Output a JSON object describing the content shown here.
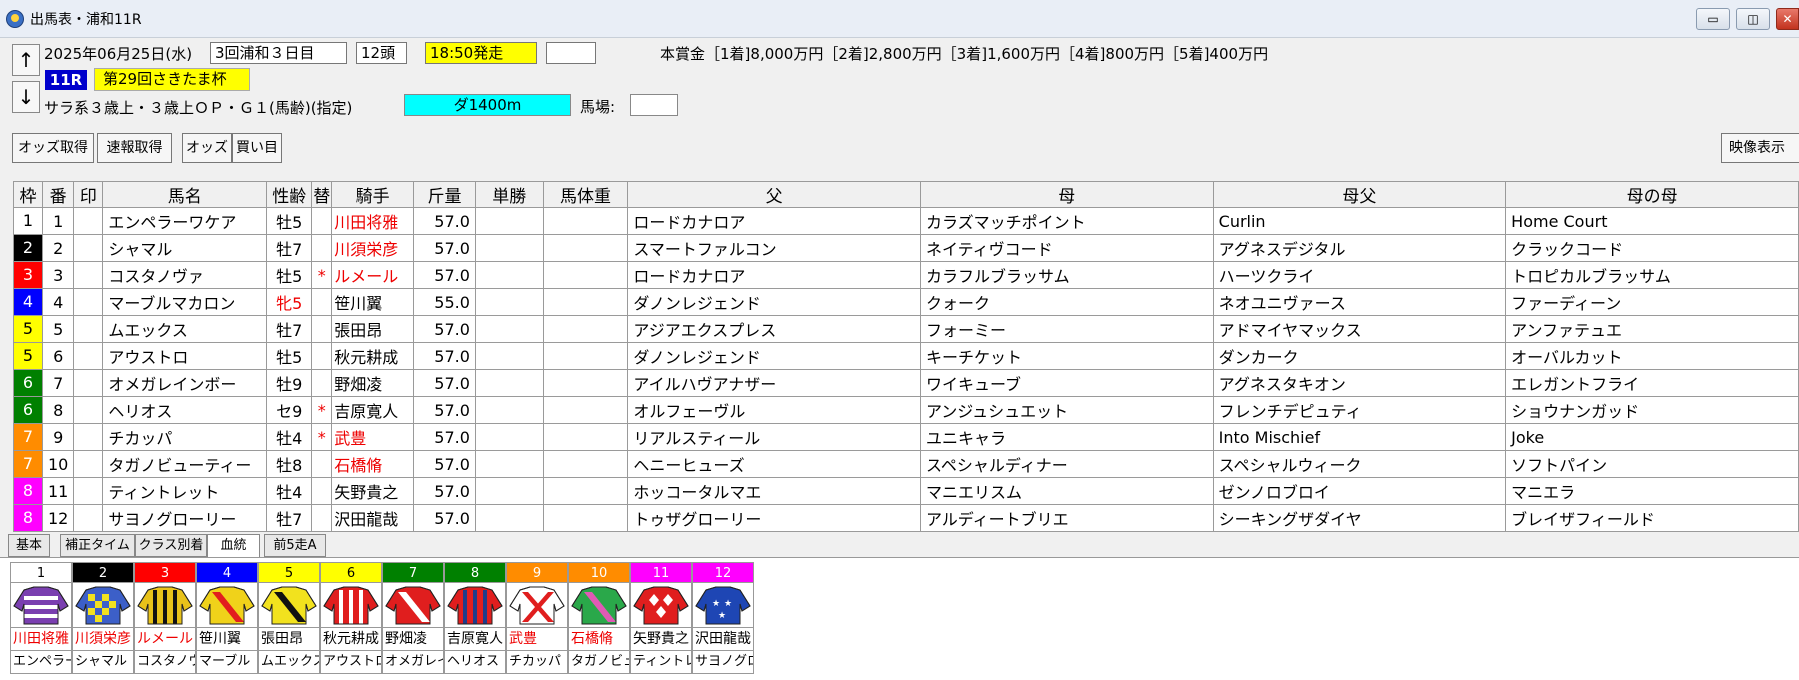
{
  "window": {
    "title": "出馬表・浦和11R",
    "minimize": "▭",
    "restore": "◫",
    "close": "✕"
  },
  "nav": {
    "up": "↑",
    "down": "↓"
  },
  "header": {
    "date": "2025年06月25日(水)",
    "meeting": "3回浦和３日目",
    "heads": "12頭",
    "post_time": "18:50発走",
    "prize": "本賞金［1着]8,000万円［2着]2,800万円［3着]1,600万円［4着]800万円［5着]400万円",
    "race_no": "11R",
    "race_name": "第29回さきたま杯",
    "conditions": "サラ系３歳上・３歳上ＯＰ・Ｇ１(馬齢)(指定)",
    "course": "ダ1400m",
    "baba_label": "馬場:"
  },
  "toolbar": {
    "odds_get": "オッズ取得",
    "sokuho_get": "速報取得",
    "odds": "オッズ",
    "kaime": "買い目",
    "video": "映像表示"
  },
  "table": {
    "headers": [
      "枠",
      "番",
      "印",
      "馬名",
      "性齢",
      "替",
      "騎手",
      "斤量",
      "単勝",
      "馬体重",
      "父",
      "母",
      "母父",
      "母の母"
    ],
    "rows": [
      {
        "waku": "1",
        "num": "1",
        "mark": "",
        "name": "エンペラーワケア",
        "sexage": "牡5",
        "kae": "",
        "jockey": "川田将雅",
        "weight": "57.0",
        "odds": "",
        "bw": "",
        "sire": "ロードカナロア",
        "dam": "カラズマッチポイント",
        "damsire": "Curlin",
        "damdam": "Home Court"
      },
      {
        "waku": "2",
        "num": "2",
        "mark": "",
        "name": "シャマル",
        "sexage": "牡7",
        "kae": "",
        "jockey": "川須栄彦",
        "weight": "57.0",
        "odds": "",
        "bw": "",
        "sire": "スマートファルコン",
        "dam": "ネイティヴコード",
        "damsire": "アグネスデジタル",
        "damdam": "クラックコード"
      },
      {
        "waku": "3",
        "num": "3",
        "mark": "",
        "name": "コスタノヴァ",
        "sexage": "牡5",
        "kae": "*",
        "jockey": "ルメール",
        "weight": "57.0",
        "odds": "",
        "bw": "",
        "sire": "ロードカナロア",
        "dam": "カラフルブラッサム",
        "damsire": "ハーツクライ",
        "damdam": "トロピカルブラッサム"
      },
      {
        "waku": "4",
        "num": "4",
        "mark": "",
        "name": "マーブルマカロン",
        "sexage": "牝5",
        "kae": "",
        "jockey": "笹川翼",
        "weight": "55.0",
        "odds": "",
        "bw": "",
        "sire": "ダノンレジェンド",
        "dam": "クォーク",
        "damsire": "ネオユニヴァース",
        "damdam": "ファーディーン"
      },
      {
        "waku": "5",
        "num": "5",
        "mark": "",
        "name": "ムエックス",
        "sexage": "牡7",
        "kae": "",
        "jockey": "張田昂",
        "weight": "57.0",
        "odds": "",
        "bw": "",
        "sire": "アジアエクスプレス",
        "dam": "フォーミー",
        "damsire": "アドマイヤマックス",
        "damdam": "アンファテュエ"
      },
      {
        "waku": "5",
        "num": "6",
        "mark": "",
        "name": "アウストロ",
        "sexage": "牡5",
        "kae": "",
        "jockey": "秋元耕成",
        "weight": "57.0",
        "odds": "",
        "bw": "",
        "sire": "ダノンレジェンド",
        "dam": "キーチケット",
        "damsire": "ダンカーク",
        "damdam": "オーバルカット"
      },
      {
        "waku": "6",
        "num": "7",
        "mark": "",
        "name": "オメガレインボー",
        "sexage": "牡9",
        "kae": "",
        "jockey": "野畑凌",
        "weight": "57.0",
        "odds": "",
        "bw": "",
        "sire": "アイルハヴアナザー",
        "dam": "ワイキューブ",
        "damsire": "アグネスタキオン",
        "damdam": "エレガントフライ"
      },
      {
        "waku": "6",
        "num": "8",
        "mark": "",
        "name": "ヘリオス",
        "sexage": "セ9",
        "kae": "*",
        "jockey": "吉原寛人",
        "weight": "57.0",
        "odds": "",
        "bw": "",
        "sire": "オルフェーヴル",
        "dam": "アンジュシュエット",
        "damsire": "フレンチデピュティ",
        "damdam": "ショウナンガッド"
      },
      {
        "waku": "7",
        "num": "9",
        "mark": "",
        "name": "チカッパ",
        "sexage": "牡4",
        "kae": "*",
        "jockey": "武豊",
        "weight": "57.0",
        "odds": "",
        "bw": "",
        "sire": "リアルスティール",
        "dam": "ユニキャラ",
        "damsire": "Into Mischief",
        "damdam": "Joke"
      },
      {
        "waku": "7",
        "num": "10",
        "mark": "",
        "name": "タガノビューティー",
        "sexage": "牡8",
        "kae": "",
        "jockey": "石橋脩",
        "weight": "57.0",
        "odds": "",
        "bw": "",
        "sire": "ヘニーヒューズ",
        "dam": "スペシャルディナー",
        "damsire": "スペシャルウィーク",
        "damdam": "ソフトパイン"
      },
      {
        "waku": "8",
        "num": "11",
        "mark": "",
        "name": "ティントレット",
        "sexage": "牡4",
        "kae": "",
        "jockey": "矢野貴之",
        "weight": "57.0",
        "odds": "",
        "bw": "",
        "sire": "ホッコータルマエ",
        "dam": "マニエリスム",
        "damsire": "ゼンノロブロイ",
        "damdam": "マニエラ"
      },
      {
        "waku": "8",
        "num": "12",
        "mark": "",
        "name": "サヨノグローリー",
        "sexage": "牡7",
        "kae": "",
        "jockey": "沢田龍哉",
        "weight": "57.0",
        "odds": "",
        "bw": "",
        "sire": "トゥザグローリー",
        "dam": "アルディートブリエ",
        "damsire": "シーキングザダイヤ",
        "damdam": "ブレイザフィールド"
      }
    ]
  },
  "tabs": [
    "基本",
    "補正タイム",
    "クラス別着",
    "血統",
    "前5走A"
  ],
  "silks": [
    {
      "num": "1",
      "jockey": "川田将雅",
      "horse": "エンペラー"
    },
    {
      "num": "2",
      "jockey": "川須栄彦",
      "horse": "シャマル"
    },
    {
      "num": "3",
      "jockey": "ルメール",
      "horse": "コスタノヴ"
    },
    {
      "num": "4",
      "jockey": "笹川翼",
      "horse": "マーブル"
    },
    {
      "num": "5",
      "jockey": "張田昂",
      "horse": "ムエックス"
    },
    {
      "num": "6",
      "jockey": "秋元耕成",
      "horse": "アウストロ"
    },
    {
      "num": "7",
      "jockey": "野畑凌",
      "horse": "オメガレイ"
    },
    {
      "num": "8",
      "jockey": "吉原寛人",
      "horse": "ヘリオス"
    },
    {
      "num": "9",
      "jockey": "武豊",
      "horse": "チカッパ"
    },
    {
      "num": "10",
      "jockey": "石橋脩",
      "horse": "タガノビュ"
    },
    {
      "num": "11",
      "jockey": "矢野貴之",
      "horse": "ティントレ"
    },
    {
      "num": "12",
      "jockey": "沢田龍哉",
      "horse": "サヨノグロ"
    }
  ],
  "colors": {
    "waku": {
      "1": "#ffffff",
      "2": "#000000",
      "3": "#ff0000",
      "4": "#0000ff",
      "5": "#ffff00",
      "6": "#008000",
      "7": "#ff8c00",
      "8": "#ff00ff"
    },
    "waku_text": {
      "1": "#000000",
      "2": "#ffffff",
      "3": "#ffffff",
      "4": "#ffffff",
      "5": "#000000",
      "6": "#ffffff",
      "7": "#ffffff",
      "8": "#ffffff"
    },
    "red_text": "#ee0000",
    "jersey": [
      {
        "base": "#7a3fb0",
        "accent": "#ffffff",
        "pattern": "hoops"
      },
      {
        "base": "#3c5fc8",
        "accent": "#f2e21e",
        "pattern": "checks"
      },
      {
        "base": "#e8c21a",
        "accent": "#111111",
        "pattern": "stripes"
      },
      {
        "base": "#f0d21a",
        "accent": "#e21e1e",
        "pattern": "sash"
      },
      {
        "base": "#f2e21e",
        "accent": "#111111",
        "pattern": "sash"
      },
      {
        "base": "#e01e1e",
        "accent": "#ffffff",
        "pattern": "stripes"
      },
      {
        "base": "#e01e1e",
        "accent": "#ffffff",
        "pattern": "sash"
      },
      {
        "base": "#e01e1e",
        "accent": "#1e3c8a",
        "pattern": "stripes"
      },
      {
        "base": "#ffffff",
        "accent": "#e01e1e",
        "pattern": "cross"
      },
      {
        "base": "#2aa84a",
        "accent": "#e05ab4",
        "pattern": "sash"
      },
      {
        "base": "#e01e1e",
        "accent": "#ffffff",
        "pattern": "diamonds"
      },
      {
        "base": "#1e46b4",
        "accent": "#ffffff",
        "pattern": "stars"
      }
    ]
  }
}
